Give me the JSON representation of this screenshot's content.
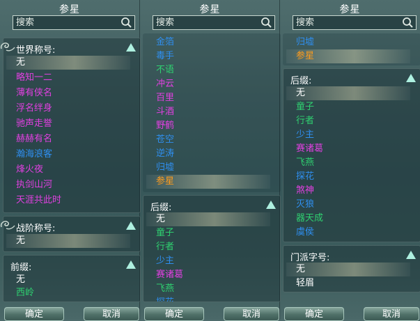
{
  "panels": [
    {
      "title": "参星",
      "search_placeholder": "搜索",
      "sections": [
        {
          "label": "世界称号:",
          "items": [
            {
              "text": "无",
              "color": "#ffffff",
              "selected": true
            },
            {
              "text": "略知一二",
              "color": "#e040e0"
            },
            {
              "text": "薄有侠名",
              "color": "#e040e0"
            },
            {
              "text": "浮名绊身",
              "color": "#e040e0"
            },
            {
              "text": "驰声走誉",
              "color": "#e040e0"
            },
            {
              "text": "赫赫有名",
              "color": "#e040e0"
            },
            {
              "text": "瀚海浪客",
              "color": "#2f8ff0"
            },
            {
              "text": "烽火夜",
              "color": "#e040e0"
            },
            {
              "text": "执剑山河",
              "color": "#e040e0"
            },
            {
              "text": "天涯共此时",
              "color": "#e040e0"
            }
          ]
        },
        {
          "label": "战阶称号:",
          "items": [
            {
              "text": "无",
              "color": "#ffffff",
              "selected": true
            }
          ]
        },
        {
          "label": "前缀:",
          "items": [
            {
              "text": "无",
              "color": "#ffffff"
            },
            {
              "text": "西岭",
              "color": "#2fd070"
            }
          ]
        }
      ],
      "confirm": "确定",
      "cancel": "取消"
    },
    {
      "title": "参星",
      "search_placeholder": "搜索",
      "list": [
        {
          "text": "金箔",
          "color": "#2f8ff0"
        },
        {
          "text": "毒手",
          "color": "#2f8ff0"
        },
        {
          "text": "不语",
          "color": "#2fd070"
        },
        {
          "text": "冲云",
          "color": "#e040e0"
        },
        {
          "text": "百里",
          "color": "#e040e0"
        },
        {
          "text": "斗酒",
          "color": "#e040e0"
        },
        {
          "text": "野鹤",
          "color": "#e040e0"
        },
        {
          "text": "苍空",
          "color": "#2f8ff0"
        },
        {
          "text": "逆涛",
          "color": "#2f8ff0"
        },
        {
          "text": "归墟",
          "color": "#2f8ff0"
        },
        {
          "text": "参星",
          "color": "#ff9c1c",
          "selected": true
        }
      ],
      "sections": [
        {
          "label": "后缀:",
          "items": [
            {
              "text": "无",
              "color": "#ffffff",
              "selected": true
            },
            {
              "text": "童子",
              "color": "#2fd070"
            },
            {
              "text": "行者",
              "color": "#2fd070"
            },
            {
              "text": "少主",
              "color": "#2f8ff0"
            },
            {
              "text": "赛诸葛",
              "color": "#e040e0"
            },
            {
              "text": "飞燕",
              "color": "#2fd070"
            },
            {
              "text": "探花",
              "color": "#2f8ff0"
            }
          ]
        }
      ],
      "confirm": "确定",
      "cancel": "取消"
    },
    {
      "title": "参星",
      "search_placeholder": "搜索",
      "list": [
        {
          "text": "归墟",
          "color": "#2f8ff0"
        },
        {
          "text": "参星",
          "color": "#ff9c1c",
          "selected": true
        }
      ],
      "sections": [
        {
          "label": "后缀:",
          "items": [
            {
              "text": "无",
              "color": "#ffffff",
              "selected": true
            },
            {
              "text": "童子",
              "color": "#2fd070"
            },
            {
              "text": "行者",
              "color": "#2fd070"
            },
            {
              "text": "少主",
              "color": "#2f8ff0"
            },
            {
              "text": "赛诸葛",
              "color": "#e040e0"
            },
            {
              "text": "飞燕",
              "color": "#2fd070"
            },
            {
              "text": "探花",
              "color": "#2f8ff0"
            },
            {
              "text": "煞神",
              "color": "#e040e0"
            },
            {
              "text": "灭狼",
              "color": "#2f8ff0"
            },
            {
              "text": "器天成",
              "color": "#2fd070"
            },
            {
              "text": "虞侯",
              "color": "#2f8ff0"
            }
          ]
        },
        {
          "label": "门派字号:",
          "items": [
            {
              "text": "无",
              "color": "#ffffff",
              "selected": true
            },
            {
              "text": "轻眉",
              "color": "#ffffff"
            }
          ]
        }
      ],
      "confirm": "确定",
      "cancel": "取消"
    }
  ],
  "icons": {
    "search": "magnifier-icon",
    "collapse": "triangle-up-icon",
    "ornament": "cloud-knot-icon"
  }
}
